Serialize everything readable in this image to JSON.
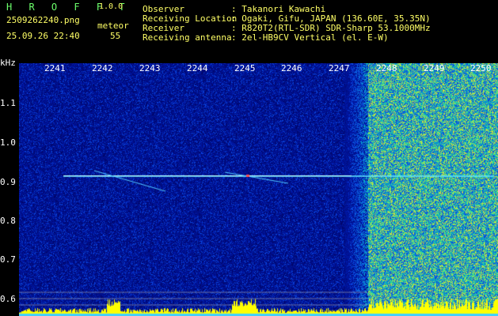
{
  "header": {
    "app_title": "H R O F F T",
    "version": "1.0.0",
    "filename": "2509262240.png",
    "datetime": "25.09.26 22:40",
    "meteor_label": "meteor",
    "meteor_count": "55",
    "info": [
      {
        "key": "Observer",
        "value": ": Takanori Kawachi"
      },
      {
        "key": "Receiving Location",
        "value": ": Ogaki, Gifu, JAPAN (136.60E, 35.35N)"
      },
      {
        "key": "Receiver",
        "value": ": R820T2(RTL-SDR) SDR-Sharp 53.1000MHz"
      },
      {
        "key": "Receiving antenna",
        "value": ": 2el-HB9CV Vertical (el. E-W)"
      }
    ]
  },
  "axes": {
    "y_unit": "kHz",
    "x_ticks": [
      "2241",
      "2242",
      "2243",
      "2244",
      "2245",
      "2246",
      "2247",
      "2248",
      "2249",
      "2250"
    ],
    "y_ticks": [
      "1.1",
      "1.0",
      "0.9",
      "0.8",
      "0.7",
      "0.6"
    ]
  },
  "colors": {
    "background": "#000000",
    "noise_dark": "#00007a",
    "noise_mid": "#1430d8",
    "signal_cyan": "#60e8ff",
    "bottom_bar": "#ffff00",
    "header_green": "#6cff6c",
    "header_yellow": "#ffff66"
  }
}
